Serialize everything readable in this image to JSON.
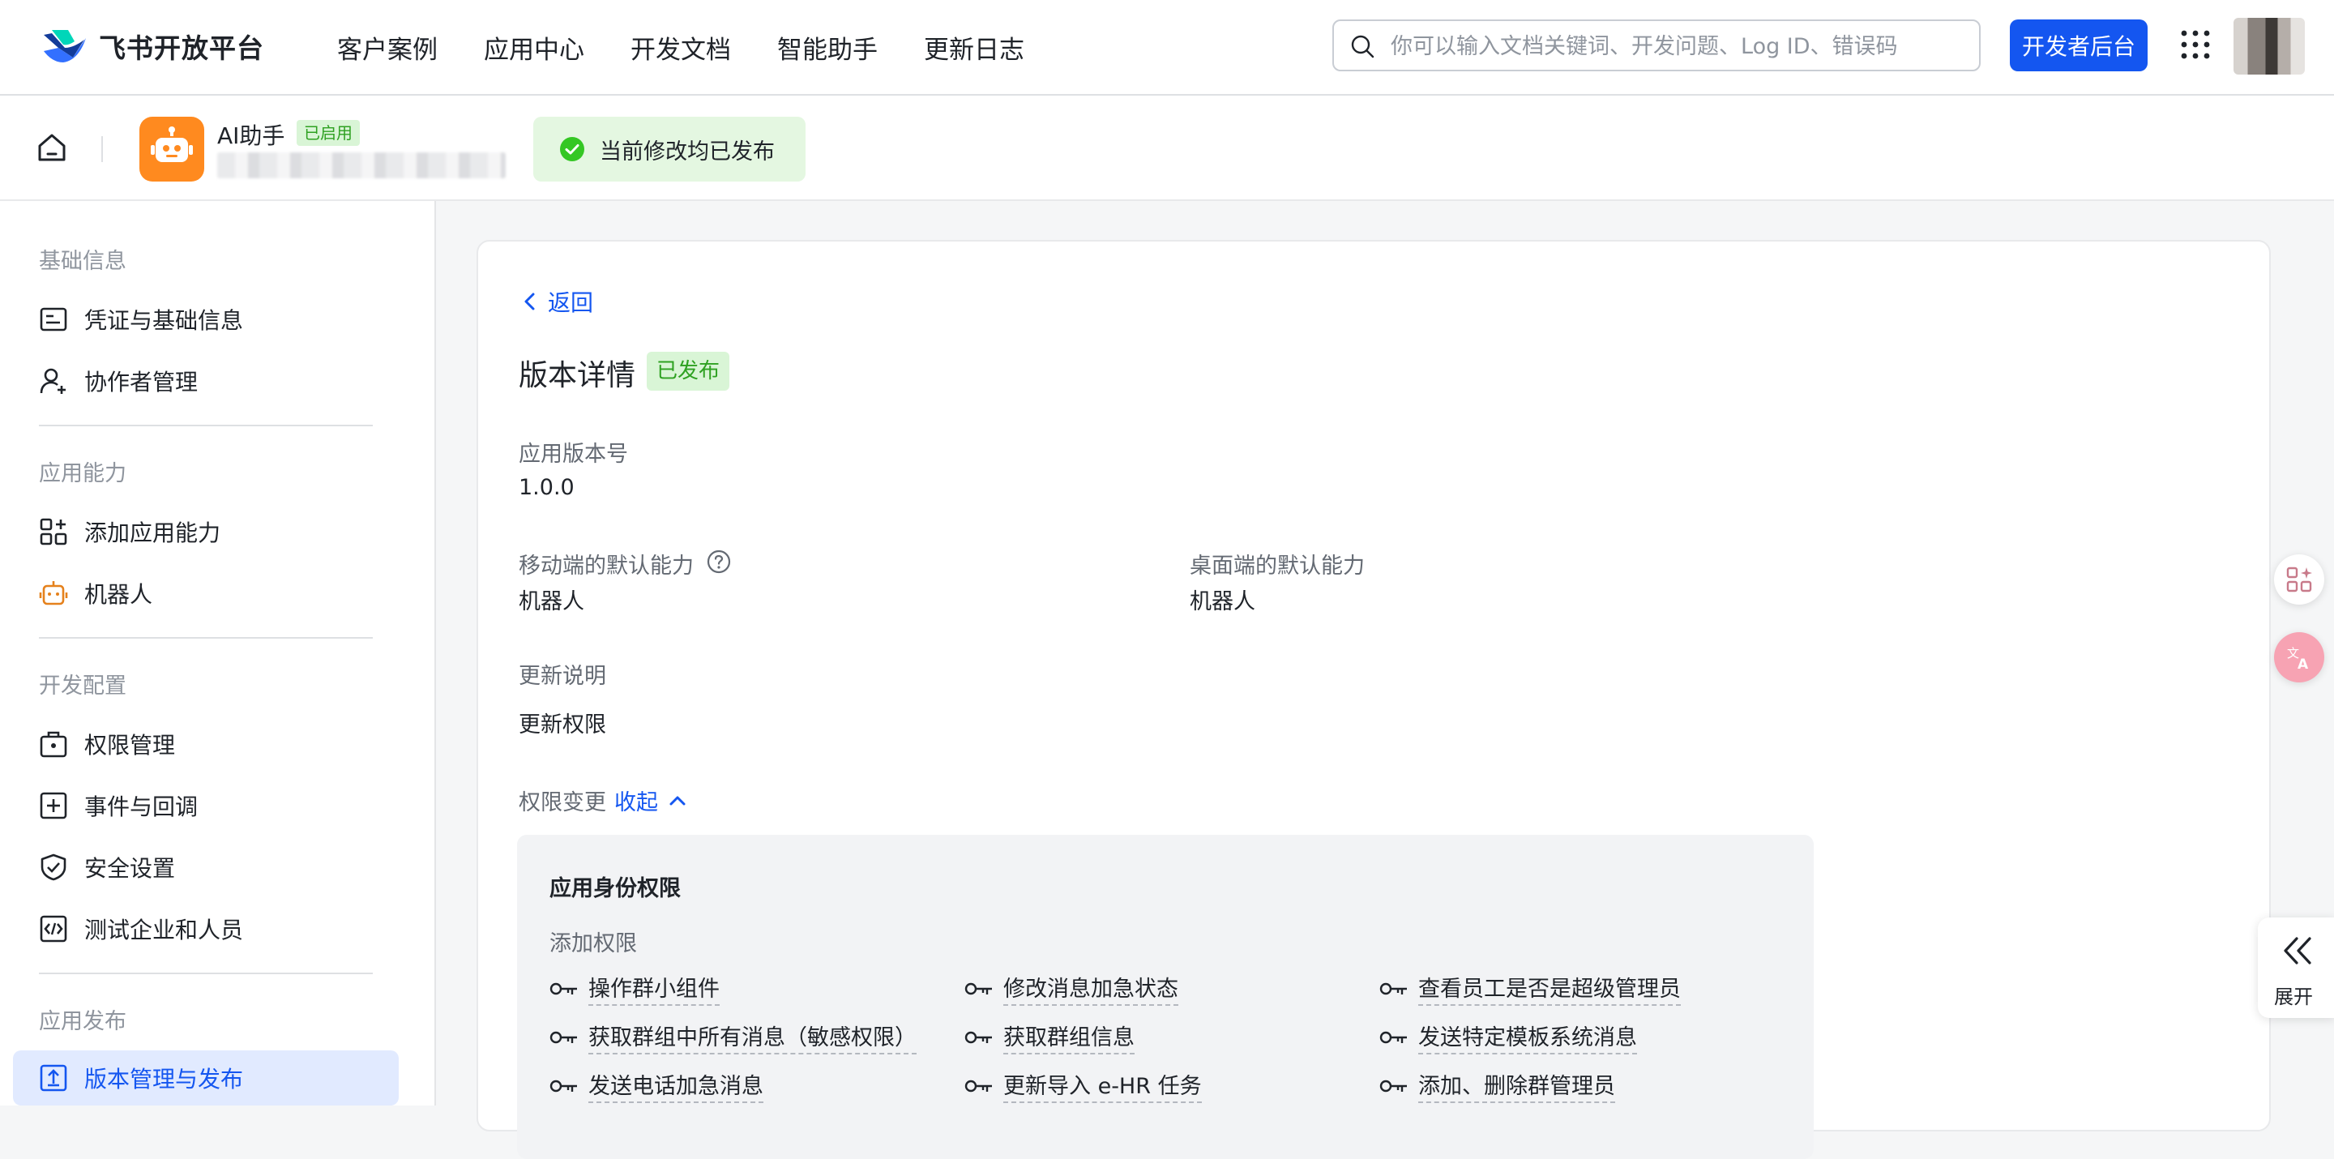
{
  "brand": {
    "name": "飞书开放平台"
  },
  "nav": {
    "items": [
      "客户案例",
      "应用中心",
      "开发文档",
      "智能助手",
      "更新日志"
    ]
  },
  "search": {
    "placeholder": "你可以输入文档关键词、开发问题、Log ID、错误码"
  },
  "dev_console_label": "开发者后台",
  "app": {
    "name": "AI助手",
    "status": "已启用"
  },
  "publish_status": "当前修改均已发布",
  "sidebar": {
    "sections": [
      {
        "title": "基础信息",
        "items": [
          {
            "label": "凭证与基础信息",
            "icon": "credential-icon"
          },
          {
            "label": "协作者管理",
            "icon": "user-add-icon"
          }
        ]
      },
      {
        "title": "应用能力",
        "items": [
          {
            "label": "添加应用能力",
            "icon": "app-grid-add-icon"
          },
          {
            "label": "机器人",
            "icon": "robot-icon"
          }
        ]
      },
      {
        "title": "开发配置",
        "items": [
          {
            "label": "权限管理",
            "icon": "permission-bag-icon"
          },
          {
            "label": "事件与回调",
            "icon": "event-plus-icon"
          },
          {
            "label": "安全设置",
            "icon": "shield-check-icon"
          },
          {
            "label": "测试企业和人员",
            "icon": "code-test-icon"
          }
        ]
      },
      {
        "title": "应用发布",
        "items": [
          {
            "label": "版本管理与发布",
            "icon": "upload-box-icon",
            "active": true
          }
        ]
      }
    ]
  },
  "detail": {
    "back_label": "返回",
    "title": "版本详情",
    "status": "已发布",
    "version_label": "应用版本号",
    "version_value": "1.0.0",
    "mobile_label": "移动端的默认能力",
    "mobile_value": "机器人",
    "desktop_label": "桌面端的默认能力",
    "desktop_value": "机器人",
    "notes_label": "更新说明",
    "notes_value": "更新权限",
    "perm_change_label": "权限变更",
    "collapse_label": "收起",
    "perm_section_title": "应用身份权限",
    "perm_add_label": "添加权限",
    "permissions": [
      "操作群小组件",
      "修改消息加急状态",
      "查看员工是否是超级管理员",
      "获取群组中所有消息（敏感权限）",
      "获取群组信息",
      "发送特定模板系统消息",
      "发送电话加急消息",
      "更新导入 e-HR 任务",
      "添加、删除群管理员"
    ]
  },
  "expand_label": "展开",
  "colors": {
    "primary": "#1456f0",
    "success_bg": "#d9f5d6",
    "success_text": "#2ea121",
    "app_icon": "#ff8a1f"
  }
}
